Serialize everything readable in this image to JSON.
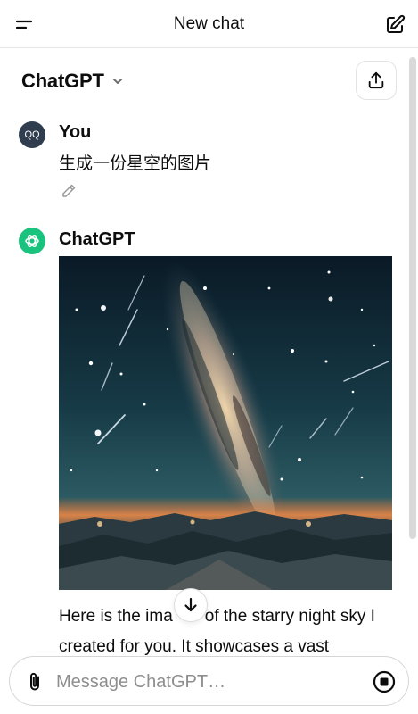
{
  "header": {
    "title": "New chat",
    "menu_icon": "menu-icon",
    "new_chat_icon": "edit-icon"
  },
  "model_selector": {
    "label": "ChatGPT",
    "icon": "chevron-down-icon"
  },
  "share_button": {
    "icon": "share-icon"
  },
  "conversation": {
    "user": {
      "avatar_text": "QQ",
      "name": "You",
      "message": "生成一份星空的图片",
      "edit_icon": "pencil-icon"
    },
    "assistant": {
      "name": "ChatGPT",
      "avatar_icon": "openai-logo-icon",
      "image_subject": "starry-night-sky-milky-way",
      "text_line1": "Here is the ima",
      "text_line1_cont": "of the starry night sky I",
      "text_line2": "created for you. It showcases a vast"
    }
  },
  "scroll_down_icon": "arrow-down-icon",
  "composer": {
    "placeholder": "Message ChatGPT…",
    "attach_icon": "paperclip-icon",
    "stop_icon": "stop-icon"
  },
  "colors": {
    "assistant_avatar": "#19c37d",
    "user_avatar": "#2f3d4f",
    "text": "#0d0d0d"
  }
}
